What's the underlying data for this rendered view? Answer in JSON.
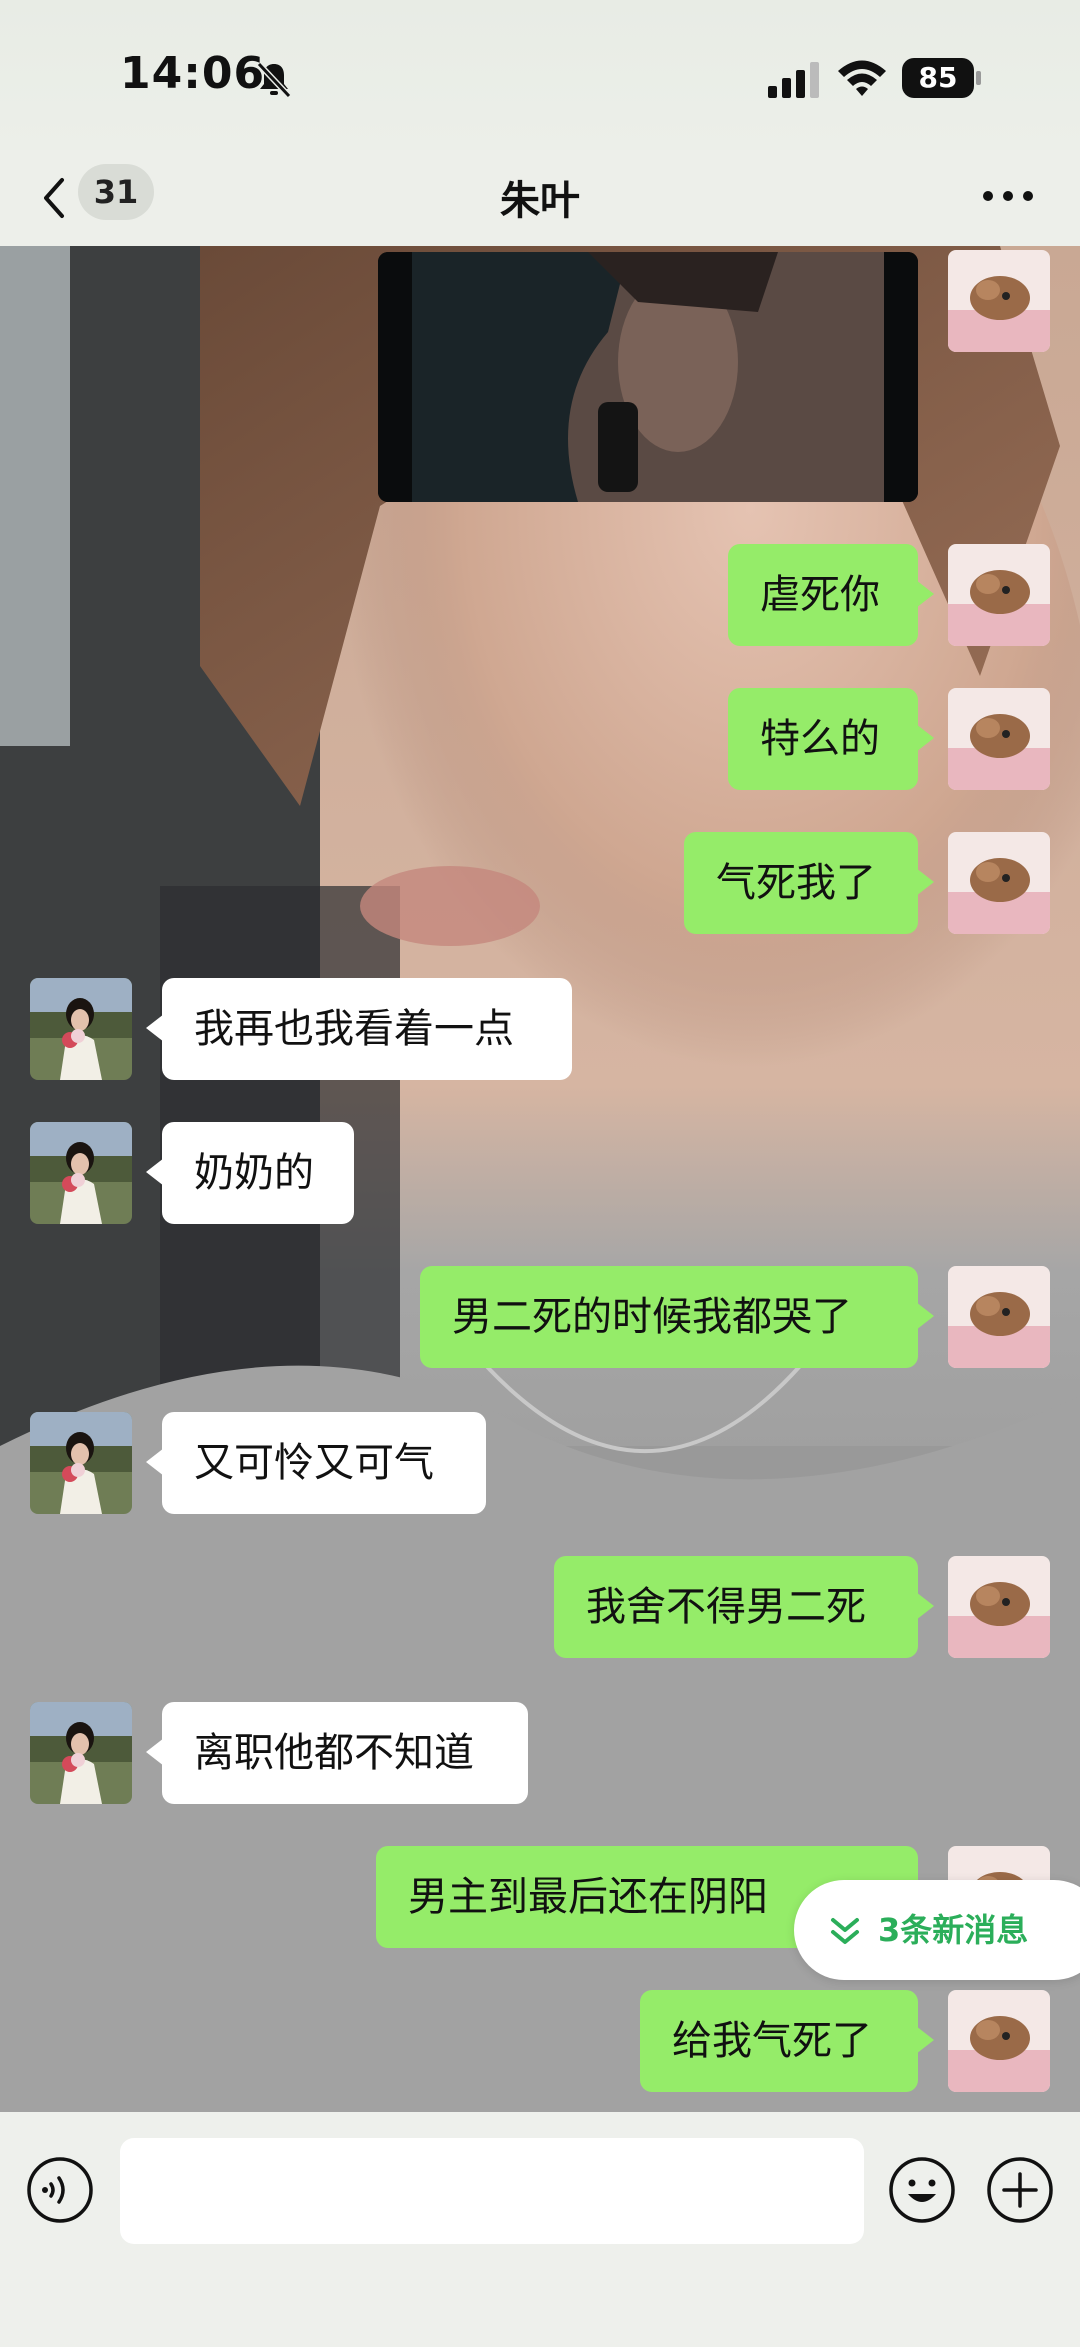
{
  "status_bar": {
    "time": "14:06",
    "battery": "85",
    "icons": [
      "bell-slash-icon",
      "cellular-signal-icon",
      "wifi-icon",
      "battery-icon"
    ]
  },
  "nav": {
    "back_icon": "chevron-left-icon",
    "unread_count": "31",
    "title": "朱叶",
    "more_icon": "more-dots-icon"
  },
  "chat": {
    "messages": [
      {
        "from": "me",
        "type": "video"
      },
      {
        "from": "me",
        "text": "虐死你"
      },
      {
        "from": "me",
        "text": "特么的"
      },
      {
        "from": "me",
        "text": "气死我了"
      },
      {
        "from": "contact",
        "text": "我再也我看着一点"
      },
      {
        "from": "contact",
        "text": "奶奶的"
      },
      {
        "from": "me",
        "text": "男二死的时候我都哭了"
      },
      {
        "from": "contact",
        "text": "又可怜又可气"
      },
      {
        "from": "me",
        "text": "我舍不得男二死"
      },
      {
        "from": "contact",
        "text": "离职他都不知道"
      },
      {
        "from": "me",
        "text": "男主到最后还在阴阳"
      },
      {
        "from": "me",
        "text": "给我气死了"
      }
    ],
    "new_messages": {
      "label": "3条新消息",
      "icon": "double-chevron-down-icon"
    }
  },
  "input_bar": {
    "placeholder": "",
    "value": "",
    "voice_icon": "voice-icon",
    "emoji_icon": "emoji-icon",
    "plus_icon": "plus-icon"
  },
  "colors": {
    "outgoing_bubble": "#95ec69",
    "incoming_bubble": "#ffffff",
    "accent_green": "#2bae5a"
  }
}
